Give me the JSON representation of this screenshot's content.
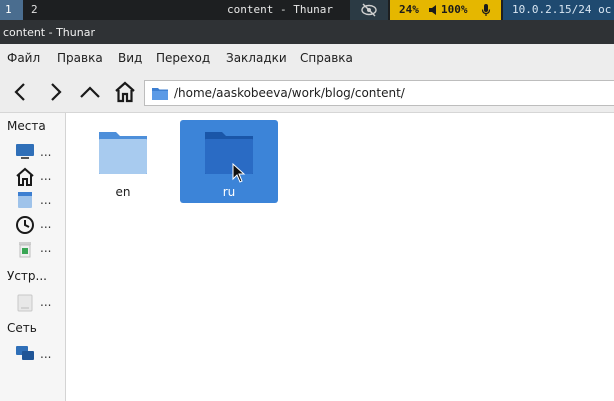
{
  "system_bar": {
    "workspaces": [
      "1",
      "2"
    ],
    "window_title": "content - Thunar",
    "battery": "24%",
    "volume": "100%",
    "network": "10.0.2.15/24 ос",
    "colors": {
      "accent_yellow": "#e5b700",
      "net_blue": "#1f4a70",
      "active_ws": "#4a6d8f"
    }
  },
  "window": {
    "title": "content - Thunar"
  },
  "menu": {
    "items": [
      "Файл",
      "Правка",
      "Вид",
      "Переход",
      "Закладки",
      "Справка"
    ]
  },
  "toolbar": {
    "back_icon": "chevron-left-icon",
    "forward_icon": "chevron-right-icon",
    "up_icon": "chevron-up-icon",
    "home_icon": "home-icon",
    "location_path": "/home/aaskobeeva/work/blog/content/"
  },
  "sidebar": {
    "sections": [
      {
        "title": "Места",
        "items": [
          {
            "icon": "computer-icon",
            "label": "..."
          },
          {
            "icon": "home-icon",
            "label": "..."
          },
          {
            "icon": "desktop-icon",
            "label": "..."
          },
          {
            "icon": "recent-icon",
            "label": "..."
          },
          {
            "icon": "trash-icon",
            "label": "..."
          }
        ]
      },
      {
        "title": "Устр...",
        "items": [
          {
            "icon": "drive-icon",
            "label": "..."
          }
        ]
      },
      {
        "title": "Сеть",
        "items": [
          {
            "icon": "network-icon",
            "label": "..."
          }
        ]
      }
    ]
  },
  "files": [
    {
      "name": "en",
      "selected": false
    },
    {
      "name": "ru",
      "selected": true
    }
  ],
  "selection_color": "#3c84d8"
}
